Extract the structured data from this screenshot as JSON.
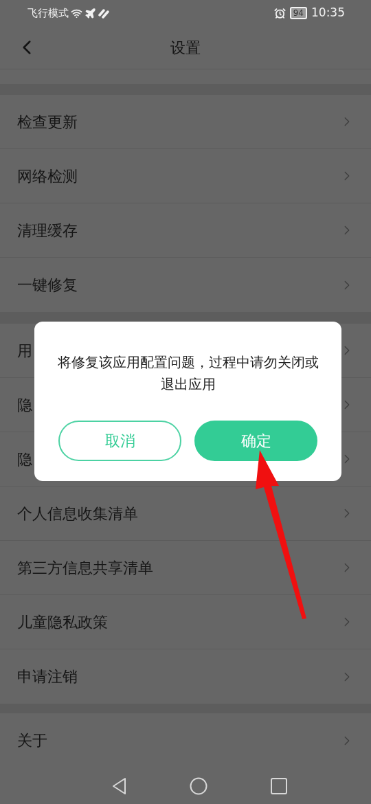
{
  "status_bar": {
    "mode": "飞行模式",
    "battery": "94",
    "time": "10:35"
  },
  "header": {
    "title": "设置"
  },
  "groups": [
    {
      "items": [
        "检查更新",
        "网络检测",
        "清理缓存",
        "一键修复"
      ]
    },
    {
      "items": [
        "用",
        "隐",
        "隐",
        "个人信息收集清单",
        "第三方信息共享清单",
        "儿童隐私政策",
        "申请注销"
      ]
    },
    {
      "items": [
        "关于"
      ]
    }
  ],
  "dialog": {
    "message": "将修复该应用配置问题，过程中请勿关闭或退出应用",
    "buttons": [
      {
        "label": "取消",
        "kind": "outline"
      },
      {
        "label": "确定",
        "kind": "filled"
      }
    ]
  }
}
